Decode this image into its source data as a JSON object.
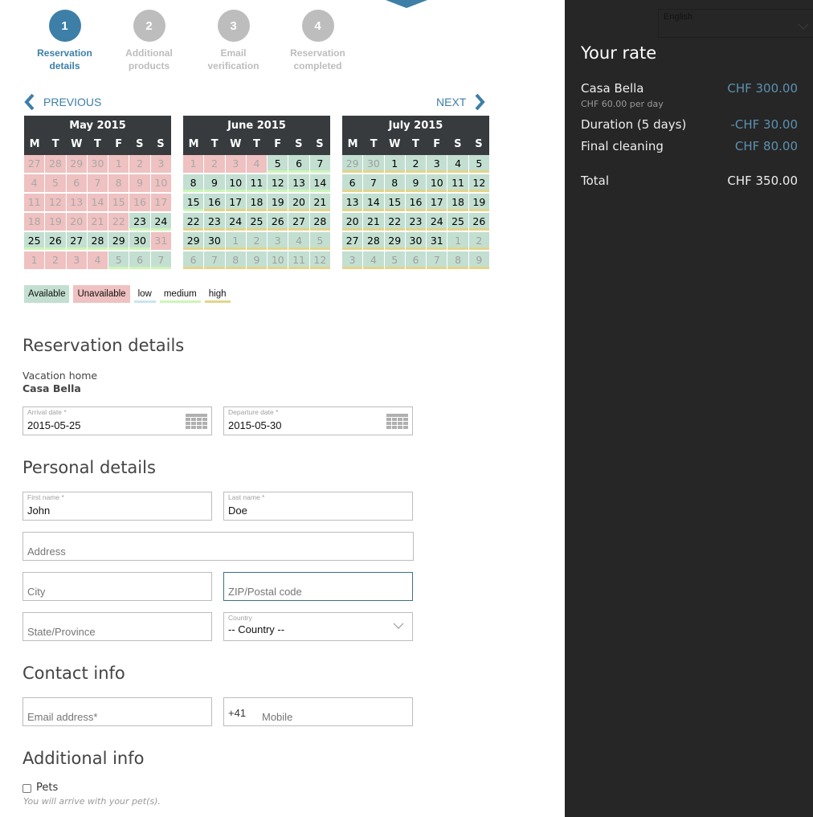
{
  "steps": [
    {
      "number": "1",
      "label_line1": "Reservation",
      "label_line2": "details",
      "active": true
    },
    {
      "number": "2",
      "label_line1": "Additional",
      "label_line2": "products",
      "active": false
    },
    {
      "number": "3",
      "label_line1": "Email",
      "label_line2": "verification",
      "active": false
    },
    {
      "number": "4",
      "label_line1": "Reservation",
      "label_line2": "completed",
      "active": false
    }
  ],
  "nav": {
    "previous": "PREVIOUS",
    "next": "NEXT"
  },
  "weekdays": [
    "M",
    "T",
    "W",
    "T",
    "F",
    "S",
    "S"
  ],
  "calendars": [
    {
      "title": "May 2015",
      "days": [
        {
          "d": "27",
          "s": "unavail",
          "o": true
        },
        {
          "d": "28",
          "s": "unavail",
          "o": true
        },
        {
          "d": "29",
          "s": "unavail",
          "o": true
        },
        {
          "d": "30",
          "s": "unavail",
          "o": true
        },
        {
          "d": "1",
          "s": "unavail"
        },
        {
          "d": "2",
          "s": "unavail"
        },
        {
          "d": "3",
          "s": "unavail"
        },
        {
          "d": "4",
          "s": "unavail"
        },
        {
          "d": "5",
          "s": "unavail"
        },
        {
          "d": "6",
          "s": "unavail"
        },
        {
          "d": "7",
          "s": "unavail"
        },
        {
          "d": "8",
          "s": "unavail"
        },
        {
          "d": "9",
          "s": "unavail"
        },
        {
          "d": "10",
          "s": "unavail"
        },
        {
          "d": "11",
          "s": "unavail"
        },
        {
          "d": "12",
          "s": "unavail"
        },
        {
          "d": "13",
          "s": "unavail"
        },
        {
          "d": "14",
          "s": "unavail"
        },
        {
          "d": "15",
          "s": "unavail"
        },
        {
          "d": "16",
          "s": "unavail"
        },
        {
          "d": "17",
          "s": "unavail"
        },
        {
          "d": "18",
          "s": "unavail"
        },
        {
          "d": "19",
          "s": "unavail"
        },
        {
          "d": "20",
          "s": "unavail"
        },
        {
          "d": "21",
          "s": "unavail"
        },
        {
          "d": "22",
          "s": "unavail"
        },
        {
          "d": "23",
          "s": "avail",
          "r": "medium"
        },
        {
          "d": "24",
          "s": "avail",
          "r": "medium"
        },
        {
          "d": "25",
          "s": "avail",
          "r": "medium"
        },
        {
          "d": "26",
          "s": "avail",
          "r": "medium"
        },
        {
          "d": "27",
          "s": "avail",
          "r": "medium"
        },
        {
          "d": "28",
          "s": "avail",
          "r": "medium"
        },
        {
          "d": "29",
          "s": "avail",
          "r": "medium"
        },
        {
          "d": "30",
          "s": "avail",
          "r": "medium"
        },
        {
          "d": "31",
          "s": "unavail"
        },
        {
          "d": "1",
          "s": "unavail",
          "o": true
        },
        {
          "d": "2",
          "s": "unavail",
          "o": true
        },
        {
          "d": "3",
          "s": "unavail",
          "o": true
        },
        {
          "d": "4",
          "s": "unavail",
          "o": true
        },
        {
          "d": "5",
          "s": "avail",
          "o": true,
          "r": "medium"
        },
        {
          "d": "6",
          "s": "avail",
          "o": true,
          "r": "medium"
        },
        {
          "d": "7",
          "s": "avail",
          "o": true,
          "r": "medium"
        }
      ]
    },
    {
      "title": "June 2015",
      "days": [
        {
          "d": "1",
          "s": "unavail"
        },
        {
          "d": "2",
          "s": "unavail"
        },
        {
          "d": "3",
          "s": "unavail"
        },
        {
          "d": "4",
          "s": "unavail"
        },
        {
          "d": "5",
          "s": "avail",
          "r": "medium"
        },
        {
          "d": "6",
          "s": "avail",
          "r": "medium"
        },
        {
          "d": "7",
          "s": "avail",
          "r": "medium"
        },
        {
          "d": "8",
          "s": "avail",
          "r": "medium"
        },
        {
          "d": "9",
          "s": "avail",
          "r": "medium"
        },
        {
          "d": "10",
          "s": "avail",
          "r": "medium"
        },
        {
          "d": "11",
          "s": "avail",
          "r": "medium"
        },
        {
          "d": "12",
          "s": "avail",
          "r": "medium"
        },
        {
          "d": "13",
          "s": "avail",
          "r": "medium"
        },
        {
          "d": "14",
          "s": "avail",
          "r": "medium"
        },
        {
          "d": "15",
          "s": "avail",
          "r": "medium"
        },
        {
          "d": "16",
          "s": "avail",
          "r": "high"
        },
        {
          "d": "17",
          "s": "avail",
          "r": "high"
        },
        {
          "d": "18",
          "s": "avail",
          "r": "high"
        },
        {
          "d": "19",
          "s": "avail",
          "r": "high"
        },
        {
          "d": "20",
          "s": "avail",
          "r": "high"
        },
        {
          "d": "21",
          "s": "avail",
          "r": "high"
        },
        {
          "d": "22",
          "s": "avail",
          "r": "high"
        },
        {
          "d": "23",
          "s": "avail",
          "r": "high"
        },
        {
          "d": "24",
          "s": "avail",
          "r": "high"
        },
        {
          "d": "25",
          "s": "avail",
          "r": "high"
        },
        {
          "d": "26",
          "s": "avail",
          "r": "high"
        },
        {
          "d": "27",
          "s": "avail",
          "r": "high"
        },
        {
          "d": "28",
          "s": "avail",
          "r": "high"
        },
        {
          "d": "29",
          "s": "avail",
          "r": "high"
        },
        {
          "d": "30",
          "s": "avail",
          "r": "high"
        },
        {
          "d": "1",
          "s": "avail",
          "o": true,
          "r": "high"
        },
        {
          "d": "2",
          "s": "avail",
          "o": true,
          "r": "high"
        },
        {
          "d": "3",
          "s": "avail",
          "o": true,
          "r": "high"
        },
        {
          "d": "4",
          "s": "avail",
          "o": true,
          "r": "high"
        },
        {
          "d": "5",
          "s": "avail",
          "o": true,
          "r": "high"
        },
        {
          "d": "6",
          "s": "avail",
          "o": true,
          "r": "high"
        },
        {
          "d": "7",
          "s": "avail",
          "o": true,
          "r": "high"
        },
        {
          "d": "8",
          "s": "avail",
          "o": true,
          "r": "high"
        },
        {
          "d": "9",
          "s": "avail",
          "o": true,
          "r": "high"
        },
        {
          "d": "10",
          "s": "avail",
          "o": true,
          "r": "high"
        },
        {
          "d": "11",
          "s": "avail",
          "o": true,
          "r": "high"
        },
        {
          "d": "12",
          "s": "avail",
          "o": true,
          "r": "high"
        }
      ]
    },
    {
      "title": "July 2015",
      "days": [
        {
          "d": "29",
          "s": "avail",
          "o": true,
          "r": "high"
        },
        {
          "d": "30",
          "s": "avail",
          "o": true,
          "r": "high"
        },
        {
          "d": "1",
          "s": "avail",
          "r": "high"
        },
        {
          "d": "2",
          "s": "avail",
          "r": "high"
        },
        {
          "d": "3",
          "s": "avail",
          "r": "high"
        },
        {
          "d": "4",
          "s": "avail",
          "r": "high"
        },
        {
          "d": "5",
          "s": "avail",
          "r": "high"
        },
        {
          "d": "6",
          "s": "avail",
          "r": "high"
        },
        {
          "d": "7",
          "s": "avail",
          "r": "high"
        },
        {
          "d": "8",
          "s": "avail",
          "r": "high"
        },
        {
          "d": "9",
          "s": "avail",
          "r": "high"
        },
        {
          "d": "10",
          "s": "avail",
          "r": "high"
        },
        {
          "d": "11",
          "s": "avail",
          "r": "high"
        },
        {
          "d": "12",
          "s": "avail",
          "r": "high"
        },
        {
          "d": "13",
          "s": "avail",
          "r": "high"
        },
        {
          "d": "14",
          "s": "avail",
          "r": "high"
        },
        {
          "d": "15",
          "s": "avail",
          "r": "high"
        },
        {
          "d": "16",
          "s": "avail",
          "r": "high"
        },
        {
          "d": "17",
          "s": "avail",
          "r": "high"
        },
        {
          "d": "18",
          "s": "avail",
          "r": "high"
        },
        {
          "d": "19",
          "s": "avail",
          "r": "high"
        },
        {
          "d": "20",
          "s": "avail",
          "r": "high"
        },
        {
          "d": "21",
          "s": "avail",
          "r": "high"
        },
        {
          "d": "22",
          "s": "avail",
          "r": "high"
        },
        {
          "d": "23",
          "s": "avail",
          "r": "high"
        },
        {
          "d": "24",
          "s": "avail",
          "r": "high"
        },
        {
          "d": "25",
          "s": "avail",
          "r": "high"
        },
        {
          "d": "26",
          "s": "avail",
          "r": "high"
        },
        {
          "d": "27",
          "s": "avail",
          "r": "high"
        },
        {
          "d": "28",
          "s": "avail",
          "r": "high"
        },
        {
          "d": "29",
          "s": "avail",
          "r": "high"
        },
        {
          "d": "30",
          "s": "avail",
          "r": "high"
        },
        {
          "d": "31",
          "s": "avail",
          "r": "high"
        },
        {
          "d": "1",
          "s": "avail",
          "o": true,
          "r": "high"
        },
        {
          "d": "2",
          "s": "avail",
          "o": true,
          "r": "high"
        },
        {
          "d": "3",
          "s": "avail",
          "o": true,
          "r": "high"
        },
        {
          "d": "4",
          "s": "avail",
          "o": true,
          "r": "high"
        },
        {
          "d": "5",
          "s": "avail",
          "o": true,
          "r": "high"
        },
        {
          "d": "6",
          "s": "avail",
          "o": true,
          "r": "high"
        },
        {
          "d": "7",
          "s": "avail",
          "o": true,
          "r": "high"
        },
        {
          "d": "8",
          "s": "avail",
          "o": true,
          "r": "high"
        },
        {
          "d": "9",
          "s": "avail",
          "o": true,
          "r": "high"
        }
      ]
    }
  ],
  "legend": {
    "available": "Available",
    "unavailable": "Unavailable",
    "low": "low",
    "medium": "medium",
    "high": "high"
  },
  "colors": {
    "accent": "#3d7fa7",
    "available": "#c3dfd1",
    "unavailable": "#efc1c1",
    "low": "#c8e6f0",
    "medium": "#cdf5b7",
    "high": "#e3d48b",
    "sidebar_bg": "#262626",
    "price": "#5c91b1"
  },
  "reservation": {
    "heading": "Reservation details",
    "property_label": "Vacation home",
    "property_name": "Casa Bella",
    "arrival_label": "Arrival date *",
    "arrival_value": "2015-05-25",
    "departure_label": "Departure date *",
    "departure_value": "2015-05-30"
  },
  "personal": {
    "heading": "Personal details",
    "first_name_label": "First name *",
    "first_name_value": "John",
    "last_name_label": "Last name *",
    "last_name_value": "Doe",
    "address_placeholder": "Address",
    "city_placeholder": "City",
    "zip_placeholder": "ZIP/Postal code",
    "state_placeholder": "State/Province",
    "country_label": "Country",
    "country_value": "-- Country --"
  },
  "contact": {
    "heading": "Contact info",
    "email_placeholder": "Email address*",
    "phone_prefix": "+41",
    "mobile_placeholder": "Mobile"
  },
  "additional": {
    "heading": "Additional info",
    "pets_label": "Pets",
    "pets_checked": false,
    "pets_help": "You will arrive with your pet(s)."
  },
  "sidebar": {
    "language": "English",
    "title": "Your rate",
    "items": [
      {
        "label": "Casa Bella",
        "amount": "CHF 300.00"
      },
      {
        "label": "Duration (5 days)",
        "amount": "-CHF 30.00"
      },
      {
        "label": "Final cleaning",
        "amount": "CHF 80.00"
      }
    ],
    "per_day": "CHF 60.00 per day",
    "total_label": "Total",
    "total_amount": "CHF 350.00"
  }
}
